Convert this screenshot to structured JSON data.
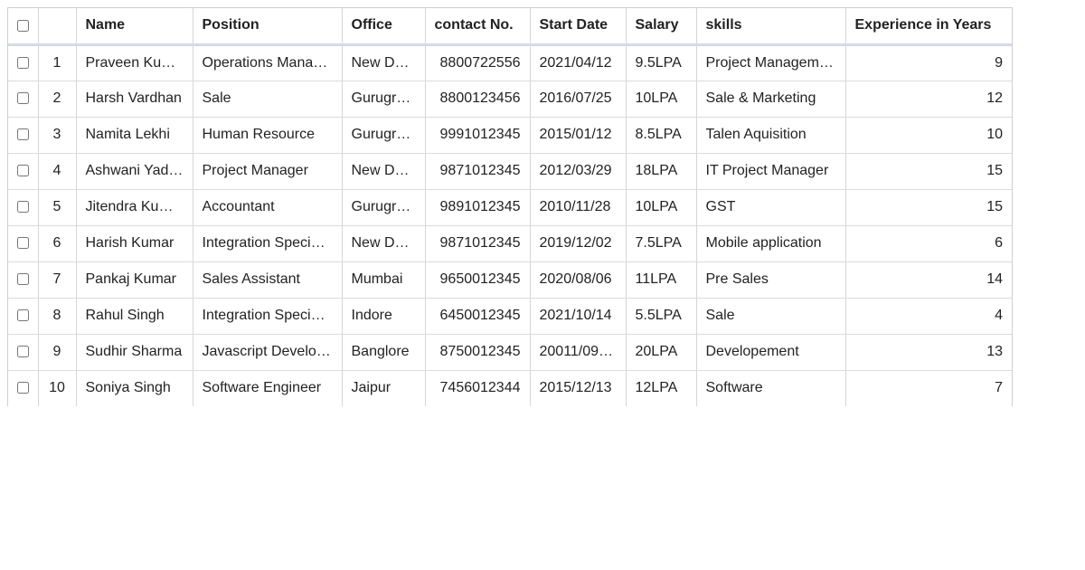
{
  "grid": {
    "columns": [
      {
        "key": "select_all",
        "label": ""
      },
      {
        "key": "row_num",
        "label": ""
      },
      {
        "key": "name",
        "label": "Name"
      },
      {
        "key": "position",
        "label": "Position"
      },
      {
        "key": "office",
        "label": "Office"
      },
      {
        "key": "contact",
        "label": "contact No."
      },
      {
        "key": "start_date",
        "label": "Start Date"
      },
      {
        "key": "salary",
        "label": "Salary"
      },
      {
        "key": "skills",
        "label": "skills"
      },
      {
        "key": "experience",
        "label": "Experience in Years"
      }
    ],
    "rows": [
      {
        "num": "1",
        "name": "Praveen Kumar",
        "position": "Operations Manager",
        "office": "New Delhi",
        "contact": "8800722556",
        "start_date": "2021/04/12",
        "salary": "9.5LPA",
        "skills": "Project Management",
        "experience": "9",
        "checked": false
      },
      {
        "num": "2",
        "name": "Harsh Vardhan",
        "position": "Sale",
        "office": "Gurugram",
        "contact": "8800123456",
        "start_date": "2016/07/25",
        "salary": "10LPA",
        "skills": "Sale & Marketing",
        "experience": "12",
        "checked": false
      },
      {
        "num": "3",
        "name": "Namita Lekhi",
        "position": "Human Resource",
        "office": "Gurugram",
        "contact": "9991012345",
        "start_date": "2015/01/12",
        "salary": "8.5LPA",
        "skills": "Talen Aquisition",
        "experience": "10",
        "checked": false
      },
      {
        "num": "4",
        "name": "Ashwani Yad…",
        "position": "Project Manager",
        "office": "New Delhi",
        "contact": "9871012345",
        "start_date": "2012/03/29",
        "salary": "18LPA",
        "skills": "IT Project Manager",
        "experience": "15",
        "checked": false
      },
      {
        "num": "5",
        "name": "Jitendra Kumar",
        "position": "Accountant",
        "office": "Gurugram",
        "contact": "9891012345",
        "start_date": "2010/11/28",
        "salary": "10LPA",
        "skills": "GST",
        "experience": "15",
        "checked": false
      },
      {
        "num": "6",
        "name": "Harish Kumar",
        "position": "Integration Special…",
        "office": "New Delhi",
        "contact": "9871012345",
        "start_date": "2019/12/02",
        "salary": "7.5LPA",
        "skills": "Mobile application",
        "experience": "6",
        "checked": false
      },
      {
        "num": "7",
        "name": "Pankaj Kumar",
        "position": "Sales Assistant",
        "office": "Mumbai",
        "contact": "9650012345",
        "start_date": "2020/08/06",
        "salary": "11LPA",
        "skills": "Pre Sales",
        "experience": "14",
        "checked": false
      },
      {
        "num": "8",
        "name": "Rahul Singh",
        "position": "Integration Special…",
        "office": "Indore",
        "contact": "6450012345",
        "start_date": "2021/10/14",
        "salary": "5.5LPA",
        "skills": "Sale",
        "experience": "4",
        "checked": false
      },
      {
        "num": "9",
        "name": "Sudhir Sharma",
        "position": "Javascript Develo…",
        "office": "Banglore",
        "contact": "8750012345",
        "start_date": "20011/09/…",
        "salary": "20LPA",
        "skills": "Developement",
        "experience": "13",
        "checked": false
      },
      {
        "num": "10",
        "name": "Soniya Singh",
        "position": "Software Engineer",
        "office": "Jaipur",
        "contact": "7456012344",
        "start_date": "2015/12/13",
        "salary": "12LPA",
        "skills": "Software",
        "experience": "7",
        "checked": false
      }
    ]
  }
}
